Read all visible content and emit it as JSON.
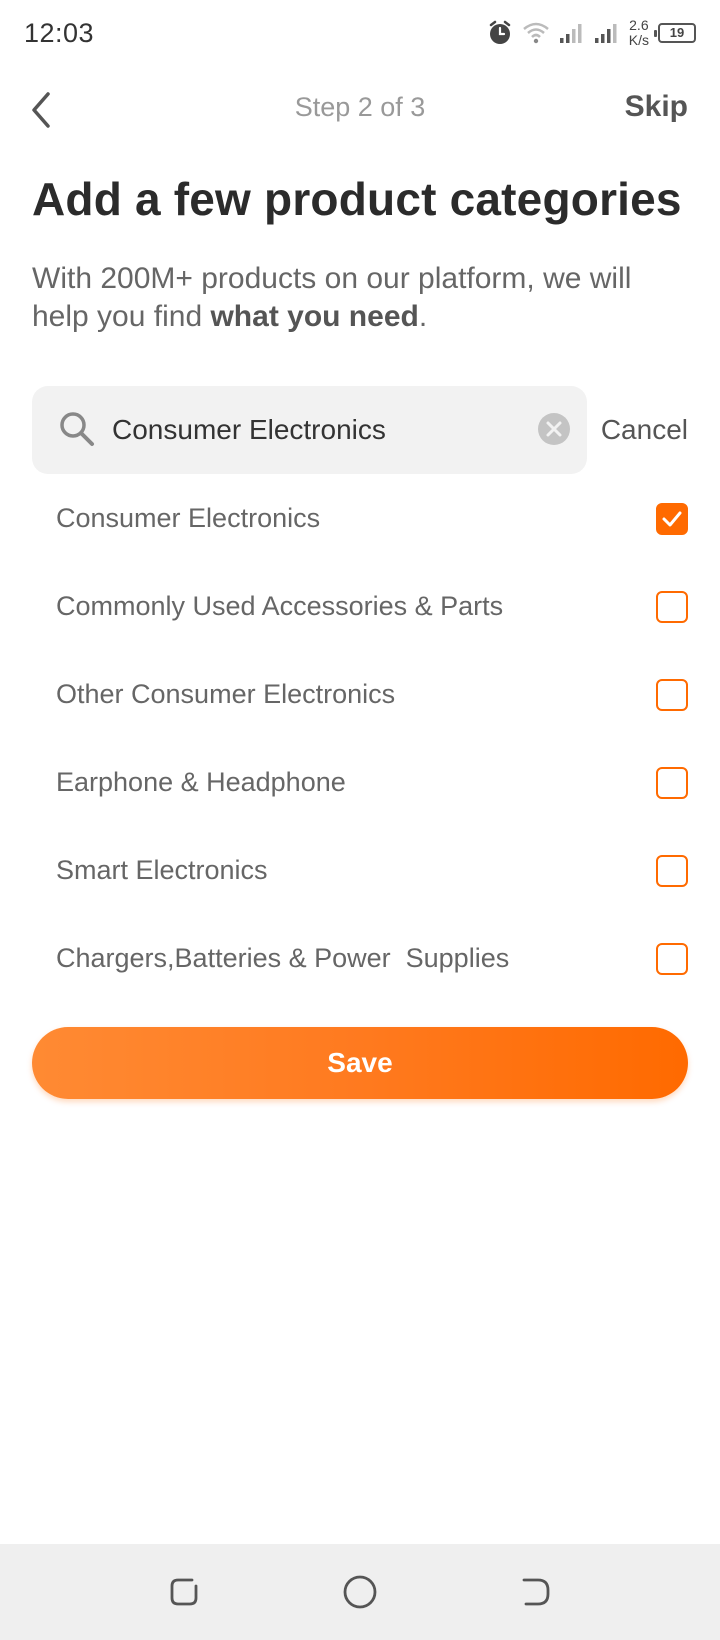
{
  "status_bar": {
    "time": "12:03",
    "net_speed_value": "2.6",
    "net_speed_unit": "K/s",
    "battery": "19",
    "icons": [
      "alarm-icon",
      "wifi-icon",
      "signal-icon",
      "signal-icon"
    ]
  },
  "header": {
    "step": "Step 2 of 3",
    "skip_label": "Skip"
  },
  "title": "Add a few product categories",
  "subtitle": {
    "text": "With 200M+ products on our platform, we will help you find ",
    "bold": "what you need",
    "end": "."
  },
  "search": {
    "value": "Consumer Electronics",
    "cancel_label": "Cancel"
  },
  "categories": [
    {
      "label": "Consumer Electronics",
      "checked": true
    },
    {
      "label": "Commonly Used Accessories & Parts",
      "checked": false
    },
    {
      "label": "Other Consumer Electronics",
      "checked": false
    },
    {
      "label": "Earphone & Headphone",
      "checked": false
    },
    {
      "label": "Smart Electronics",
      "checked": false
    },
    {
      "label": "Chargers,Batteries & Power  Supplies",
      "checked": false
    }
  ],
  "save_label": "Save",
  "colors": {
    "accent": "#ff6a00",
    "title": "#2b2b2b",
    "muted": "#999999"
  }
}
